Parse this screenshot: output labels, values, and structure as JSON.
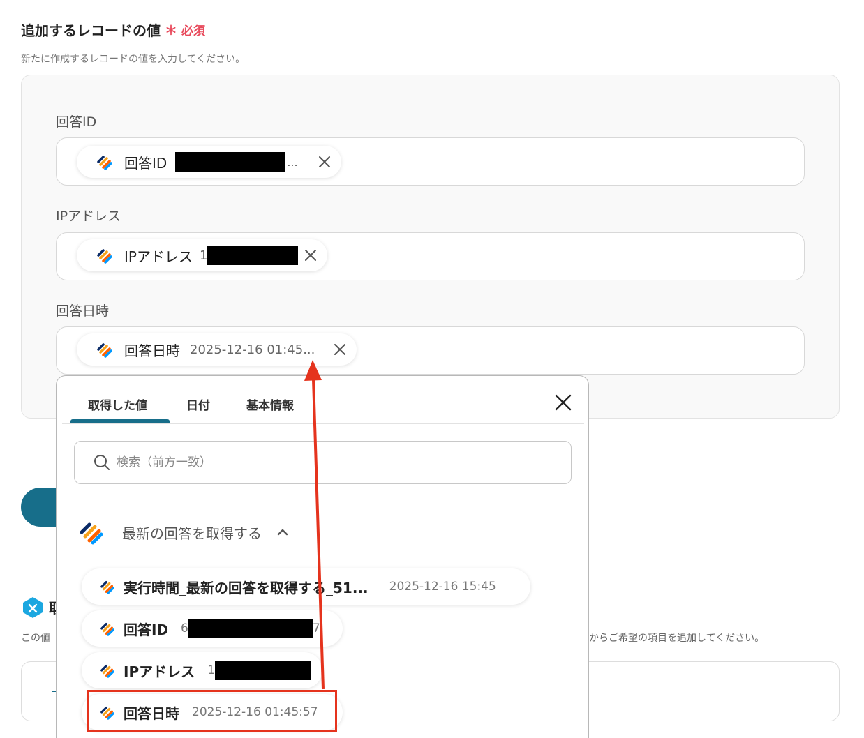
{
  "section": {
    "title": "追加するレコードの値",
    "required_mark": "＊",
    "required_label": "必須",
    "description": "新たに作成するレコードの値を入力してください。"
  },
  "fields": [
    {
      "label": "回答ID",
      "chip_name": "回答ID",
      "chip_value_prefix": "",
      "ellipsis": "..."
    },
    {
      "label": "IPアドレス",
      "chip_name": "IPアドレス",
      "chip_value_prefix": "1"
    },
    {
      "label": "回答日時",
      "chip_name": "回答日時",
      "chip_value": "2025-12-16 01:45..."
    }
  ],
  "dropdown": {
    "tabs": [
      "取得した値",
      "日付",
      "基本情報"
    ],
    "active_tab": "取得した値",
    "search_placeholder": "検索（前方一致）",
    "group_name": "最新の回答を取得する",
    "options": [
      {
        "name": "実行時間_最新の回答を取得する_51...",
        "value": "2025-12-16 15:45"
      },
      {
        "name": "回答ID",
        "value_prefix": "6",
        "value_suffix": "7"
      },
      {
        "name": "IPアドレス",
        "value_prefix": "1"
      },
      {
        "name": "回答日時",
        "value": "2025-12-16 01:45:57"
      }
    ]
  },
  "background": {
    "section_char": "取",
    "desc_left": "この値",
    "desc_right": "からご希望の項目を追加してください。",
    "box_char": "-"
  },
  "colors": {
    "accent": "#176e8a",
    "required": "#e8495b",
    "annotation": "#e5331d"
  },
  "icons": {
    "app_logo": "jotform-logo-icon",
    "close": "close-icon",
    "search": "search-icon",
    "chevron": "chevron-up-icon",
    "section_icon": "yoom-hexagon-icon"
  }
}
